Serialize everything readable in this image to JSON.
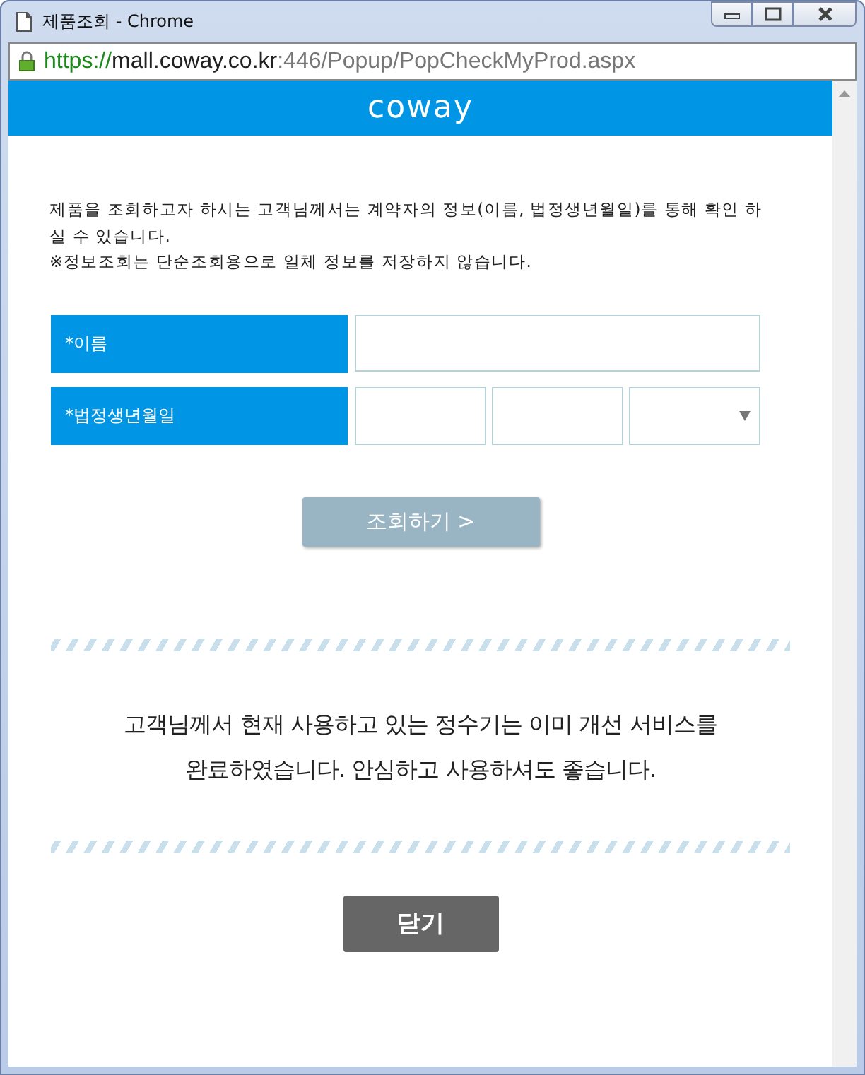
{
  "window": {
    "title": "제품조회 - Chrome"
  },
  "address_bar": {
    "scheme": "https://",
    "host": "mall.coway.co.kr",
    "path": ":446/Popup/PopCheckMyProd.aspx"
  },
  "header": {
    "logo": "coway"
  },
  "intro": [
    "제품을 조회하고자 하시는 고객님께서는 계약자의 정보(이름, 법정생년월일)를 통해 확인 하실 수 있습니다.",
    "※정보조회는 단순조회용으로 일체 정보를 저장하지 않습니다."
  ],
  "form": [
    {
      "label": "*이름",
      "kind": "text"
    },
    {
      "label": "*법정생년월일",
      "kind": "date"
    }
  ],
  "search_button": {
    "label": "조회하기",
    "arrow": ">"
  },
  "message": [
    "고객님께서 현재 사용하고 있는 정수기는 이미 개선 서비스를",
    "완료하였습니다.  안심하고 사용하셔도 좋습니다."
  ],
  "close_button": "닫기"
}
